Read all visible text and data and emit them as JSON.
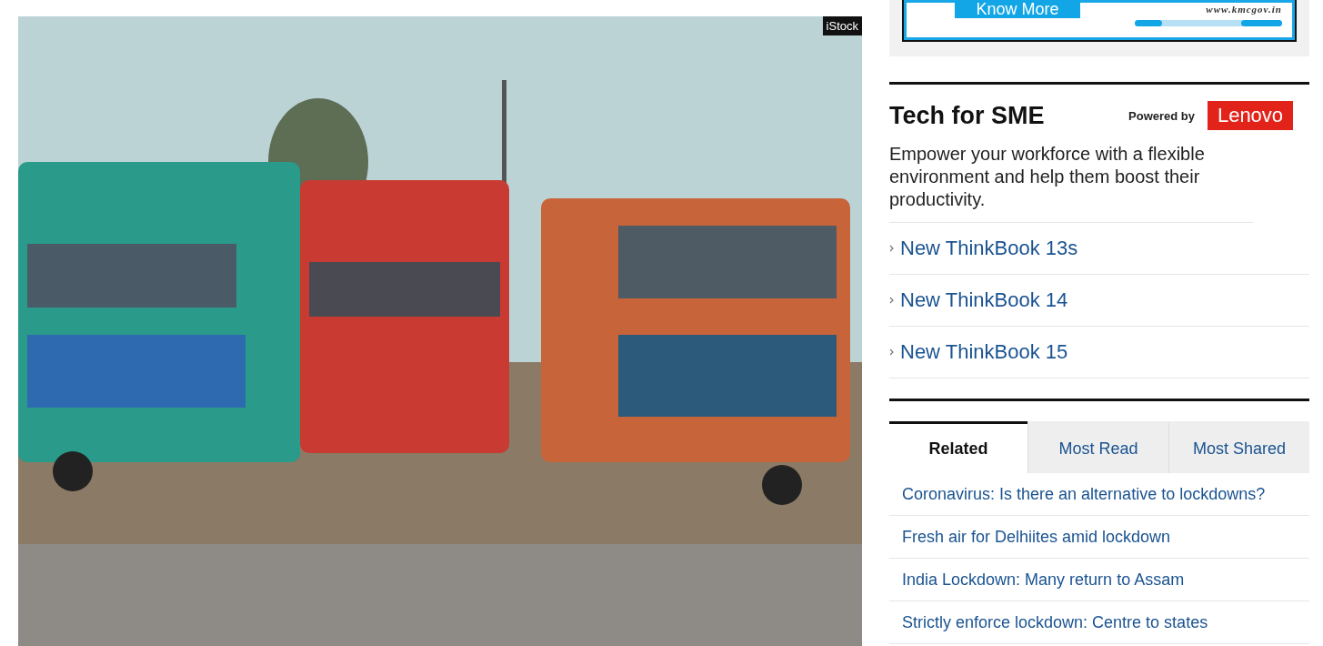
{
  "photo": {
    "credit": "iStock"
  },
  "ad": {
    "button": "Know More",
    "url": "www.kmcgov.in"
  },
  "tech_for_sme": {
    "title": "Tech for SME",
    "powered_by": "Powered by",
    "brand": "Lenovo",
    "description": "Empower your workforce with a flexible environment and help them boost their productivity.",
    "links": [
      "New ThinkBook 13s",
      "New ThinkBook 14",
      "New ThinkBook 15"
    ]
  },
  "tabs": [
    {
      "label": "Related",
      "selected": true
    },
    {
      "label": "Most Read",
      "selected": false
    },
    {
      "label": "Most Shared",
      "selected": false
    }
  ],
  "articles": [
    "Coronavirus: Is there an alternative to lockdowns?",
    "Fresh air for Delhiites amid lockdown",
    "India Lockdown: Many return to Assam",
    "Strictly enforce lockdown: Centre to states"
  ]
}
